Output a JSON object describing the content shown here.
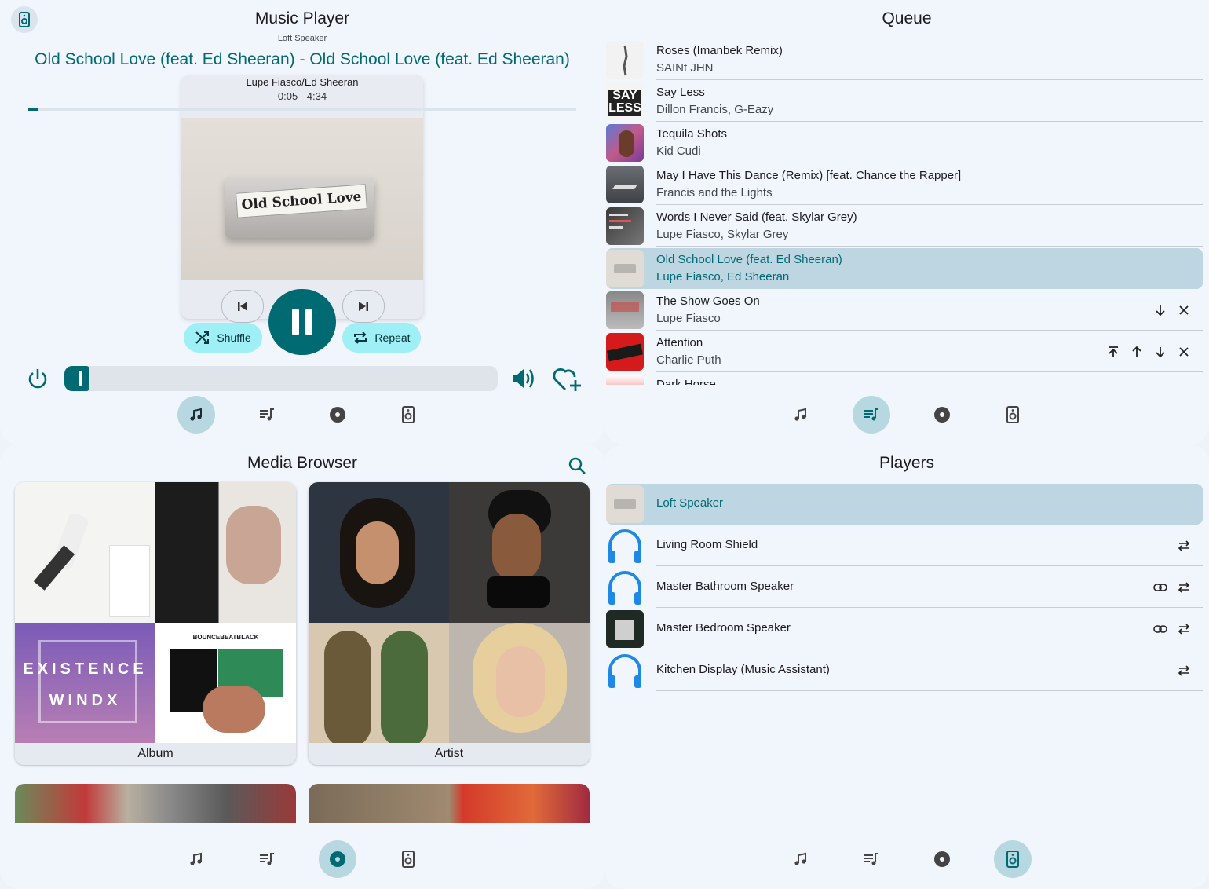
{
  "player": {
    "title": "Music Player",
    "device": "Loft Speaker",
    "track_title": "Old School Love (feat. Ed Sheeran) - Old School Love (feat. Ed Sheeran)",
    "artist": "Lupe Fiasco/Ed Sheeran",
    "time": "0:05 - 4:34",
    "progress_fraction": 0.018,
    "volume_fraction": 0.05,
    "shuffle_label": "Shuffle",
    "repeat_label": "Repeat",
    "cover_text": "Old School Love"
  },
  "queue": {
    "title": "Queue",
    "items": [
      {
        "title": "Roses (Imanbek Remix)",
        "artist": "SAINt JHN"
      },
      {
        "title": "Say Less",
        "artist": "Dillon Francis, G-Eazy"
      },
      {
        "title": "Tequila Shots",
        "artist": "Kid Cudi"
      },
      {
        "title": "May I Have This Dance (Remix) [feat. Chance the Rapper]",
        "artist": "Francis and the Lights"
      },
      {
        "title": "Words I Never Said (feat. Skylar Grey)",
        "artist": "Lupe Fiasco, Skylar Grey"
      },
      {
        "title": "Old School Love (feat. Ed Sheeran)",
        "artist": "Lupe Fiasco, Ed Sheeran"
      },
      {
        "title": "The Show Goes On",
        "artist": "Lupe Fiasco"
      },
      {
        "title": "Attention",
        "artist": "Charlie Puth"
      },
      {
        "title": "Dark Horse",
        "artist": ""
      }
    ]
  },
  "browser": {
    "title": "Media Browser",
    "cards": [
      {
        "label": "Album"
      },
      {
        "label": "Artist"
      }
    ],
    "art_text": {
      "existence": "EXISTENCE",
      "windx": "WINDX",
      "bounce": "BOUNCEBEATBLACK",
      "say": "SAY",
      "less": "LESS"
    }
  },
  "players": {
    "title": "Players",
    "items": [
      {
        "name": "Loft Speaker"
      },
      {
        "name": "Living Room Shield"
      },
      {
        "name": "Master Bathroom Speaker"
      },
      {
        "name": "Master Bedroom Speaker"
      },
      {
        "name": "Kitchen Display (Music Assistant)"
      }
    ]
  },
  "colors": {
    "accent": "#006a72",
    "selected_bg": "#bdd6e2",
    "pill_bg": "#9ef0f6",
    "headphone_blue": "#1e88e5",
    "panel_bg": "#f1f5fc"
  }
}
